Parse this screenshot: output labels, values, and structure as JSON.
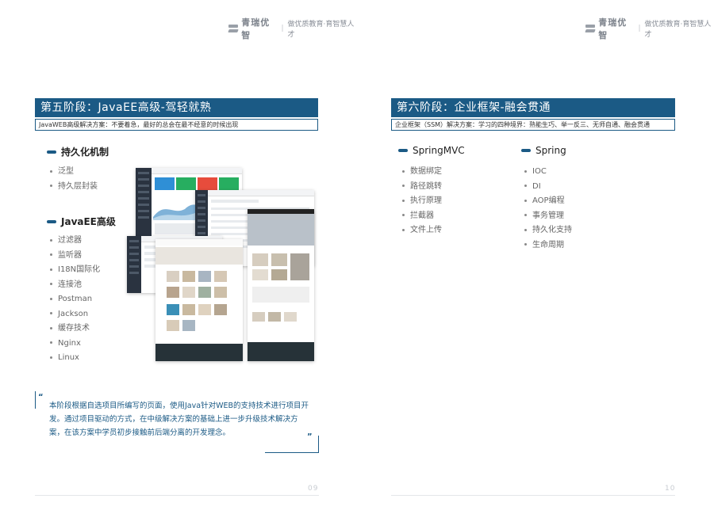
{
  "brand": {
    "name": "青瑞优智",
    "slogan": "做优质教育·育智慧人才"
  },
  "left": {
    "stage_title": "第五阶段：JavaEE高级-驾轻就熟",
    "stage_subtitle": "JavaWEB高级解决方案：不要着急，最好的总会在最不经意的时候出现",
    "sections": [
      {
        "title": "持久化机制",
        "items": [
          "泛型",
          "持久层封装"
        ]
      },
      {
        "title": "JavaEE高级",
        "items": [
          "过滤器",
          "监听器",
          "I18N国际化",
          "连接池",
          "Postman",
          "Jackson",
          "缓存技术",
          "Nginx",
          "Linux"
        ]
      }
    ],
    "quote": {
      "open": "“",
      "close": "”",
      "text": "本阶段根据自选项目所编写的页面，使用Java针对WEB的支持技术进行项目开发。通过项目驱动的方式，在中级解决方案的基础上进一步升级技术解决方案，在该方案中学员初步接触前后端分离的开发理念。"
    },
    "page_number": "09"
  },
  "right": {
    "stage_title": "第六阶段：企业框架-融会贯通",
    "stage_subtitle": "企业框架（SSM）解决方案：学习的四种境界：熟能生巧、举一反三、无师自通、融会贯通",
    "sections": [
      {
        "title": "SpringMVC",
        "items": [
          "数据绑定",
          "路径跳转",
          "执行原理",
          "拦截器",
          "文件上传"
        ]
      },
      {
        "title": "Spring",
        "items": [
          "IOC",
          "DI",
          "AOP编程",
          "事务管理",
          "持久化支持",
          "生命周期"
        ]
      }
    ],
    "page_number": "10"
  },
  "colors": {
    "accent": "#1b5a85",
    "muted": "#8a8f98"
  }
}
